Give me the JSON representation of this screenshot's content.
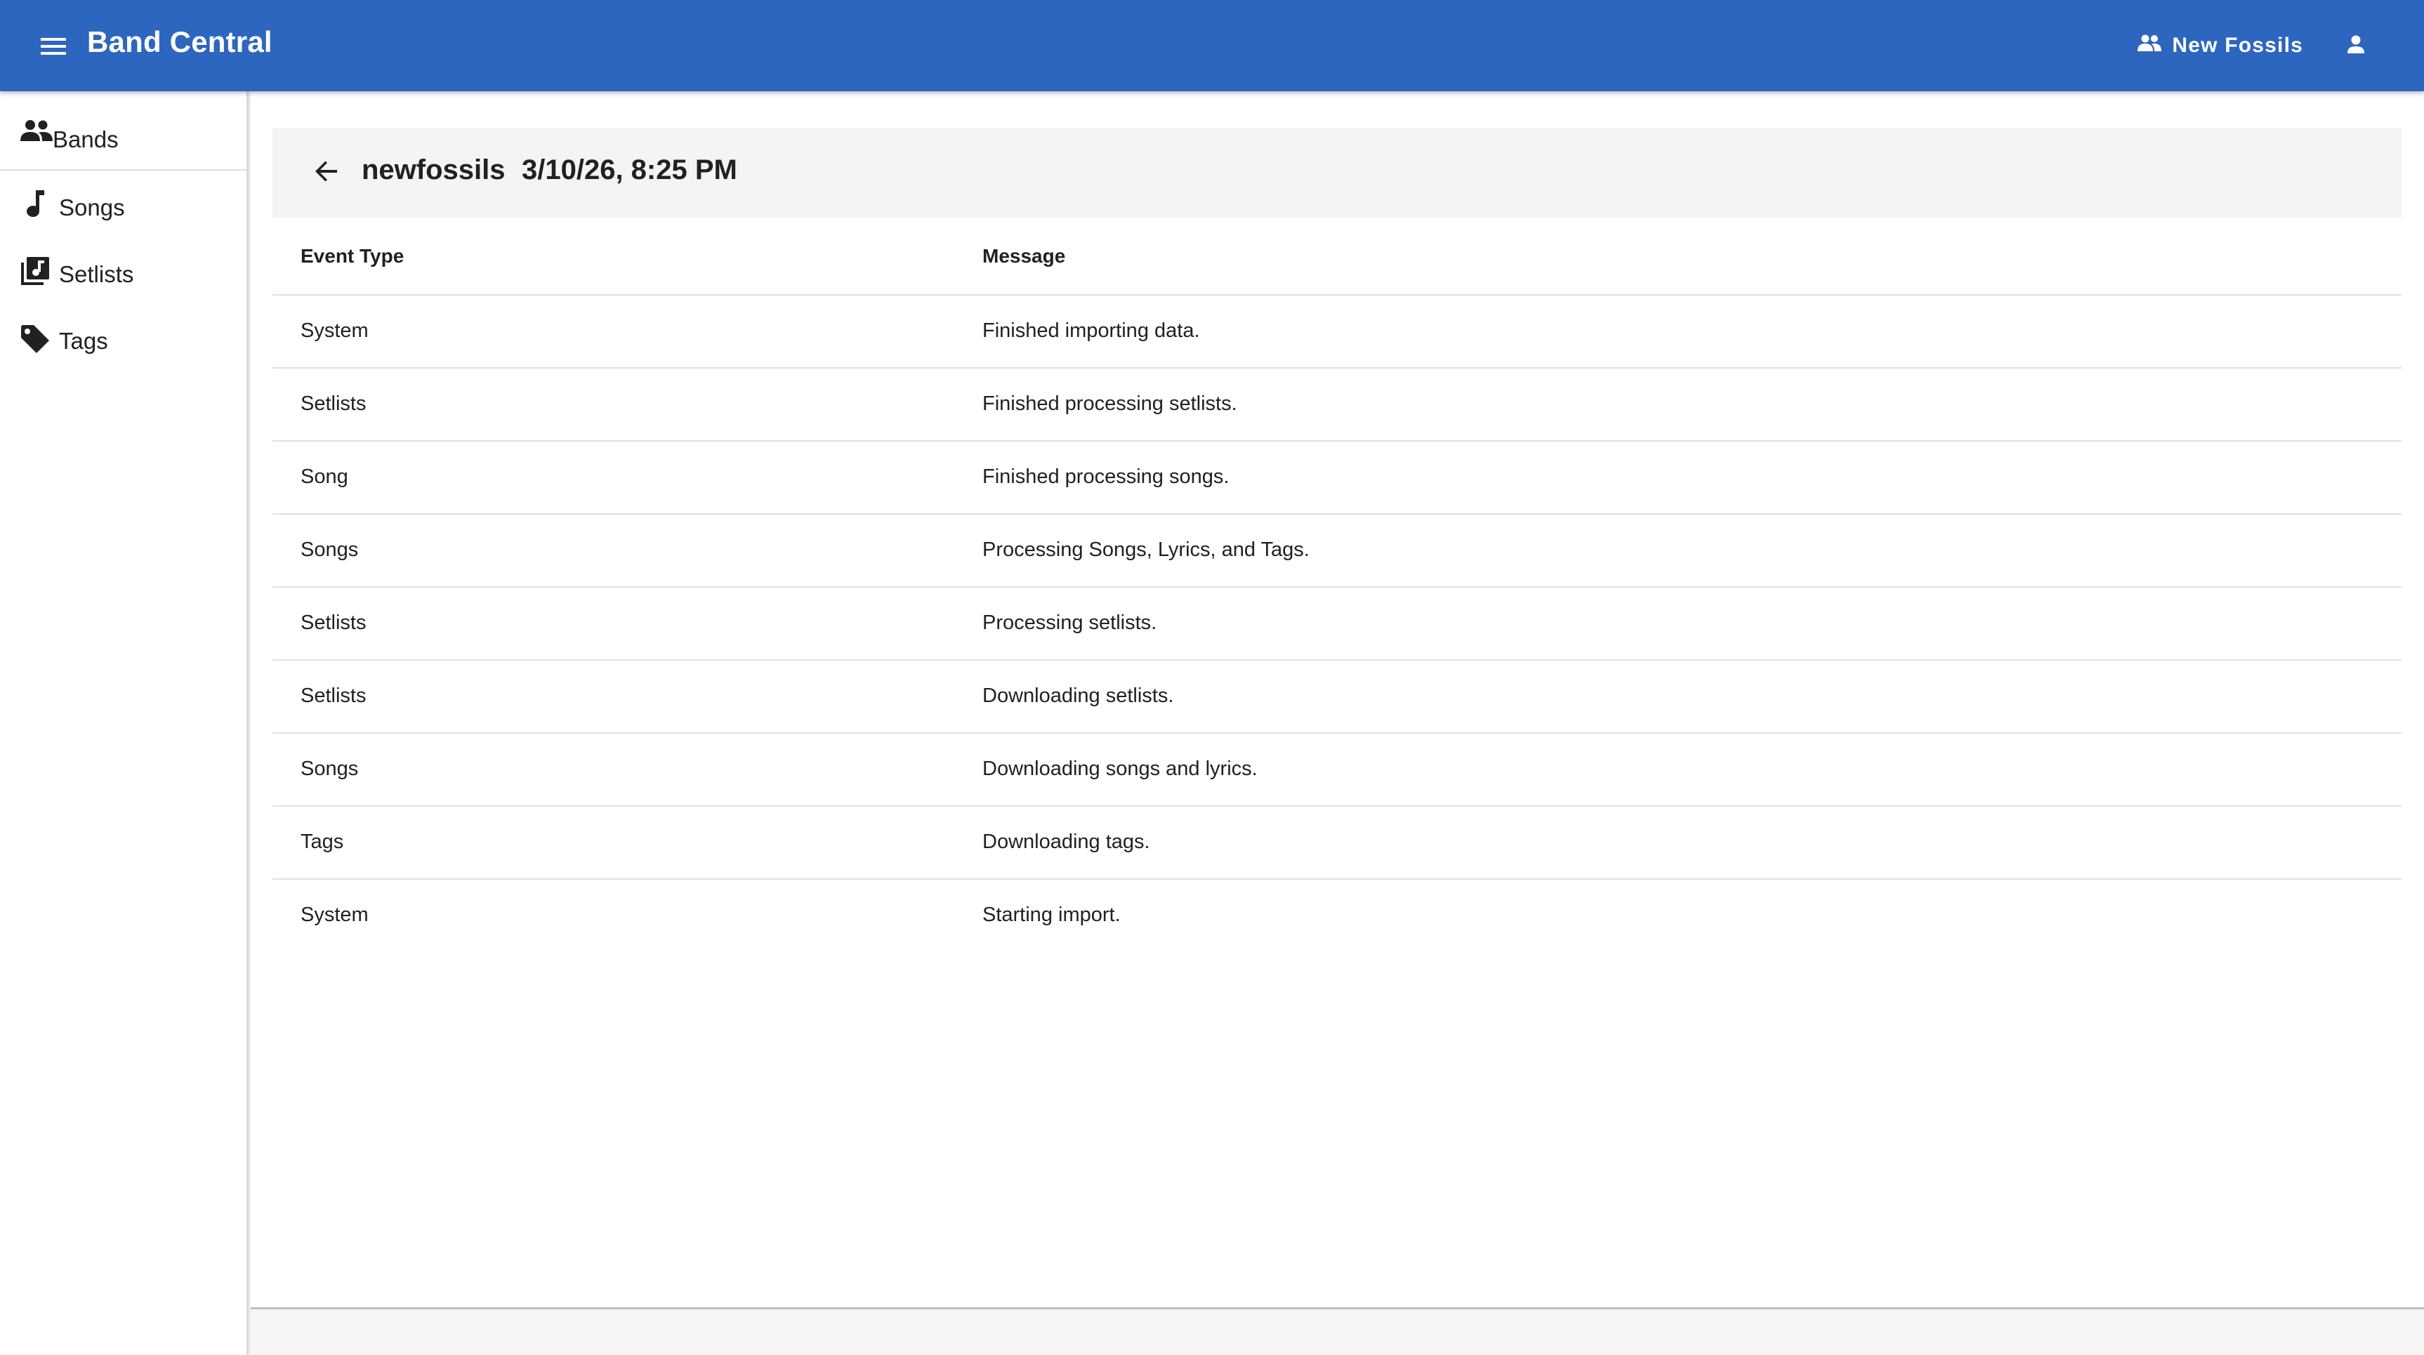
{
  "app": {
    "title": "Band Central",
    "current_band": "New Fossils",
    "colors": {
      "appbar": "#2d66bf",
      "header_card": "#f4f4f4",
      "text": "#212121"
    }
  },
  "icons": {
    "menu": "menu-icon",
    "band_switch": "group-icon",
    "account": "person-icon",
    "back": "arrow-back-icon"
  },
  "sidebar": {
    "items": [
      {
        "label": "Bands",
        "icon": "group-icon"
      },
      {
        "label": "Songs",
        "icon": "music-note-icon"
      },
      {
        "label": "Setlists",
        "icon": "library-music-icon"
      },
      {
        "label": "Tags",
        "icon": "tag-icon"
      }
    ]
  },
  "header": {
    "name": "newfossils",
    "date": "3/10/26, 8:25 PM"
  },
  "table": {
    "columns": [
      "Event Type",
      "Message"
    ],
    "rows": [
      {
        "event_type": "System",
        "message": "Finished importing data."
      },
      {
        "event_type": "Setlists",
        "message": "Finished processing setlists."
      },
      {
        "event_type": "Song",
        "message": "Finished processing songs."
      },
      {
        "event_type": "Songs",
        "message": "Processing Songs, Lyrics, and Tags."
      },
      {
        "event_type": "Setlists",
        "message": "Processing setlists."
      },
      {
        "event_type": "Setlists",
        "message": "Downloading setlists."
      },
      {
        "event_type": "Songs",
        "message": "Downloading songs and lyrics."
      },
      {
        "event_type": "Tags",
        "message": "Downloading tags."
      },
      {
        "event_type": "System",
        "message": "Starting import."
      }
    ]
  }
}
